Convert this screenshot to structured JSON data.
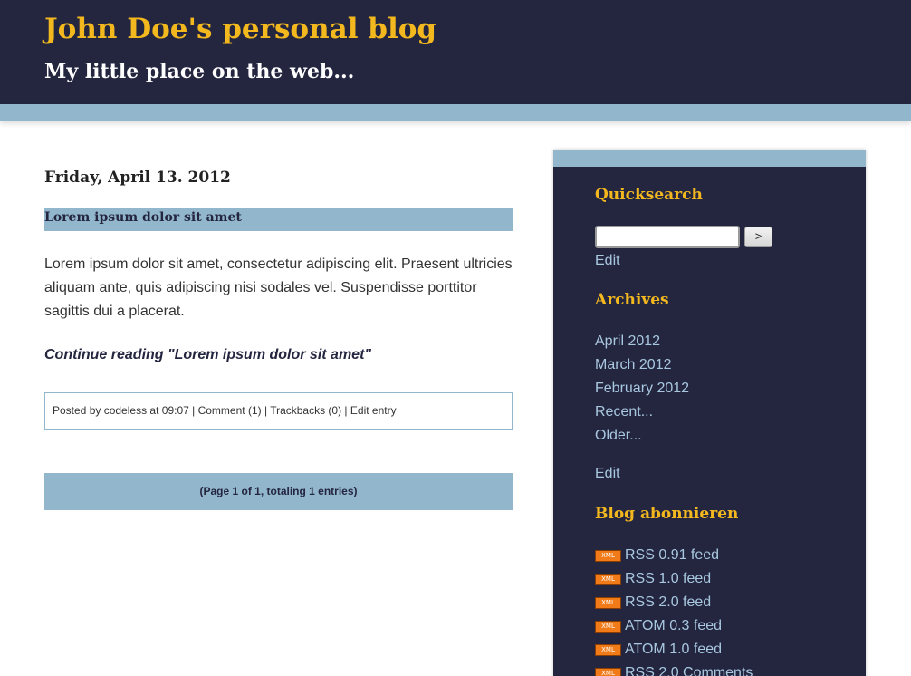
{
  "header": {
    "title": "John Doe's personal blog",
    "subtitle": "My little place on the web..."
  },
  "post": {
    "date": "Friday, April 13. 2012",
    "title": "Lorem ipsum dolor sit amet",
    "body": "Lorem ipsum dolor sit amet, consectetur adipiscing elit. Praesent ultricies aliquam ante, quis adipiscing nisi sodales vel. Suspendisse porttitor sagittis dui a placerat.",
    "continue_link": "Continue reading \"Lorem ipsum dolor sit amet\"",
    "footer": {
      "posted_by_prefix": "Posted by ",
      "author": "codeless",
      "at_prefix": " at ",
      "time": "09:07",
      "sep1": " | ",
      "comment": "Comment (1)",
      "sep2": " | ",
      "trackbacks": "Trackbacks (0)",
      "sep3": " | ",
      "edit": "Edit entry"
    }
  },
  "pagination": "(Page 1 of 1, totaling 1 entries)",
  "sidebar": {
    "quicksearch": {
      "title": "Quicksearch",
      "input_value": "",
      "button_label": ">",
      "edit": "Edit"
    },
    "archives": {
      "title": "Archives",
      "items": [
        "April 2012",
        "March 2012",
        "February 2012",
        "Recent...",
        "Older..."
      ],
      "edit": "Edit"
    },
    "subscribe": {
      "title": "Blog abonnieren",
      "badge": "XML",
      "feeds": [
        "RSS 0.91 feed",
        "RSS 1.0 feed",
        "RSS 2.0 feed",
        "ATOM 0.3 feed",
        "ATOM 1.0 feed",
        "RSS 2.0 Comments"
      ]
    }
  },
  "colors": {
    "header_bg": "#242640",
    "accent_gold": "#f3b81e",
    "accent_blue": "#92b7cc",
    "link_blue": "#a9c8e0",
    "feed_orange": "#f07b18"
  }
}
